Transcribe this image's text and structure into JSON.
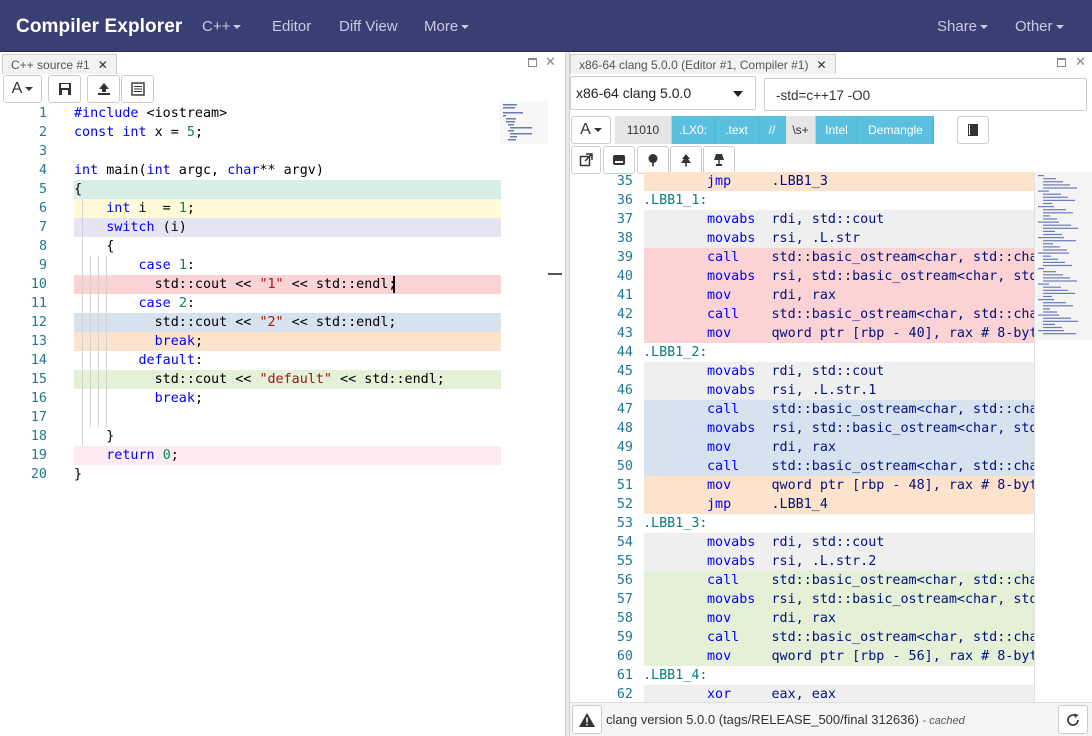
{
  "navbar": {
    "brand": "Compiler Explorer",
    "items": [
      "C++",
      "Editor",
      "Diff View",
      "More"
    ],
    "right_items": [
      "Share",
      "Other"
    ]
  },
  "source_pane": {
    "tab_title": "C++ source #1",
    "lines": [
      {
        "n": "1",
        "tokens": [
          [
            "kw",
            "#include"
          ],
          [
            "id",
            " <iostream>"
          ]
        ]
      },
      {
        "n": "2",
        "tokens": [
          [
            "kw",
            "const"
          ],
          [
            "id",
            " "
          ],
          [
            "kw",
            "int"
          ],
          [
            "id",
            " x = "
          ],
          [
            "num",
            "5"
          ],
          [
            "id",
            ";"
          ]
        ]
      },
      {
        "n": "3",
        "tokens": []
      },
      {
        "n": "4",
        "tokens": [
          [
            "kw",
            "int"
          ],
          [
            "id",
            " main("
          ],
          [
            "kw",
            "int"
          ],
          [
            "id",
            " argc, "
          ],
          [
            "kw",
            "char"
          ],
          [
            "id",
            "** argv)"
          ]
        ]
      },
      {
        "n": "5",
        "tokens": [
          [
            "id",
            "{"
          ]
        ]
      },
      {
        "n": "6",
        "tokens": [
          [
            "id",
            "    "
          ],
          [
            "kw",
            "int"
          ],
          [
            "id",
            " i  = "
          ],
          [
            "num",
            "1"
          ],
          [
            "id",
            ";"
          ]
        ]
      },
      {
        "n": "7",
        "tokens": [
          [
            "id",
            "    "
          ],
          [
            "kw",
            "switch"
          ],
          [
            "id",
            " (i)"
          ]
        ]
      },
      {
        "n": "8",
        "tokens": [
          [
            "id",
            "    {"
          ]
        ]
      },
      {
        "n": "9",
        "tokens": [
          [
            "id",
            "        "
          ],
          [
            "kw",
            "case"
          ],
          [
            "id",
            " "
          ],
          [
            "num",
            "1"
          ],
          [
            "id",
            ":"
          ]
        ]
      },
      {
        "n": "10",
        "tokens": [
          [
            "id",
            "          std::cout << "
          ],
          [
            "str",
            "\"1\""
          ],
          [
            "id",
            " << std::endl;"
          ]
        ]
      },
      {
        "n": "11",
        "tokens": [
          [
            "id",
            "        "
          ],
          [
            "kw",
            "case"
          ],
          [
            "id",
            " "
          ],
          [
            "num",
            "2"
          ],
          [
            "id",
            ":"
          ]
        ]
      },
      {
        "n": "12",
        "tokens": [
          [
            "id",
            "          std::cout << "
          ],
          [
            "str",
            "\"2\""
          ],
          [
            "id",
            " << std::endl;"
          ]
        ]
      },
      {
        "n": "13",
        "tokens": [
          [
            "id",
            "          "
          ],
          [
            "kw",
            "break"
          ],
          [
            "id",
            ";"
          ]
        ]
      },
      {
        "n": "14",
        "tokens": [
          [
            "id",
            "        "
          ],
          [
            "kw",
            "default"
          ],
          [
            "id",
            ":"
          ]
        ]
      },
      {
        "n": "15",
        "tokens": [
          [
            "id",
            "          std::cout << "
          ],
          [
            "str",
            "\"default\""
          ],
          [
            "id",
            " << std::endl;"
          ]
        ]
      },
      {
        "n": "16",
        "tokens": [
          [
            "id",
            "          "
          ],
          [
            "kw",
            "break"
          ],
          [
            "id",
            ";"
          ]
        ]
      },
      {
        "n": "17",
        "tokens": []
      },
      {
        "n": "18",
        "tokens": [
          [
            "id",
            "    }"
          ]
        ]
      },
      {
        "n": "19",
        "tokens": [
          [
            "id",
            "    "
          ],
          [
            "kw",
            "return"
          ],
          [
            "id",
            " "
          ],
          [
            "num",
            "0"
          ],
          [
            "id",
            ";"
          ]
        ]
      },
      {
        "n": "20",
        "tokens": [
          [
            "id",
            "}"
          ]
        ]
      }
    ],
    "highlights": {
      "5": "#d8efe8",
      "6": "#fdfbd8",
      "7": "#e6e4f3",
      "10": "#fbd3d4",
      "12": "#d6e3ef",
      "13": "#fde2cc",
      "15": "#e4f1d6",
      "19": "#fdeaf2"
    }
  },
  "compiler_pane": {
    "tab_title": "x86-64 clang 5.0.0 (Editor #1, Compiler #1)",
    "compiler_select": "x86-64 clang 5.0.0",
    "options_value": "-std=c++17 -O0",
    "filters": [
      {
        "label": "11010",
        "on": false
      },
      {
        "label": ".LX0:",
        "on": true
      },
      {
        "label": ".text",
        "on": true
      },
      {
        "label": "//",
        "on": true
      },
      {
        "label": "\\s+",
        "on": false
      },
      {
        "label": "Intel",
        "on": true
      },
      {
        "label": "Demangle",
        "on": true
      }
    ],
    "asm_lines": [
      {
        "n": "35",
        "label": "",
        "op": "jmp",
        "args": ".LBB1_3",
        "bg": "#fde2cc"
      },
      {
        "n": "36",
        "label": ".LBB1_1:",
        "op": "",
        "args": "",
        "bg": ""
      },
      {
        "n": "37",
        "label": "",
        "op": "movabs",
        "args": "rdi, std::cout",
        "bg": "#efefef"
      },
      {
        "n": "38",
        "label": "",
        "op": "movabs",
        "args": "rsi, .L.str",
        "bg": "#efefef"
      },
      {
        "n": "39",
        "label": "",
        "op": "call",
        "args": "std::basic_ostream<char, std::cha",
        "bg": "#fbd3d4"
      },
      {
        "n": "40",
        "label": "",
        "op": "movabs",
        "args": "rsi, std::basic_ostream<char, std",
        "bg": "#fbd3d4"
      },
      {
        "n": "41",
        "label": "",
        "op": "mov",
        "args": "rdi, rax",
        "bg": "#fbd3d4"
      },
      {
        "n": "42",
        "label": "",
        "op": "call",
        "args": "std::basic_ostream<char, std::cha",
        "bg": "#fbd3d4"
      },
      {
        "n": "43",
        "label": "",
        "op": "mov",
        "args": "qword ptr [rbp - 40], rax # 8-byt",
        "bg": "#fbd3d4"
      },
      {
        "n": "44",
        "label": ".LBB1_2:",
        "op": "",
        "args": "",
        "bg": ""
      },
      {
        "n": "45",
        "label": "",
        "op": "movabs",
        "args": "rdi, std::cout",
        "bg": "#efefef"
      },
      {
        "n": "46",
        "label": "",
        "op": "movabs",
        "args": "rsi, .L.str.1",
        "bg": "#efefef"
      },
      {
        "n": "47",
        "label": "",
        "op": "call",
        "args": "std::basic_ostream<char, std::cha",
        "bg": "#d6e3ef"
      },
      {
        "n": "48",
        "label": "",
        "op": "movabs",
        "args": "rsi, std::basic_ostream<char, std",
        "bg": "#d6e3ef"
      },
      {
        "n": "49",
        "label": "",
        "op": "mov",
        "args": "rdi, rax",
        "bg": "#d6e3ef"
      },
      {
        "n": "50",
        "label": "",
        "op": "call",
        "args": "std::basic_ostream<char, std::cha",
        "bg": "#d6e3ef"
      },
      {
        "n": "51",
        "label": "",
        "op": "mov",
        "args": "qword ptr [rbp - 48], rax # 8-byt",
        "bg": "#fde2cc"
      },
      {
        "n": "52",
        "label": "",
        "op": "jmp",
        "args": ".LBB1_4",
        "bg": "#fde2cc"
      },
      {
        "n": "53",
        "label": ".LBB1_3:",
        "op": "",
        "args": "",
        "bg": ""
      },
      {
        "n": "54",
        "label": "",
        "op": "movabs",
        "args": "rdi, std::cout",
        "bg": "#efefef"
      },
      {
        "n": "55",
        "label": "",
        "op": "movabs",
        "args": "rsi, .L.str.2",
        "bg": "#efefef"
      },
      {
        "n": "56",
        "label": "",
        "op": "call",
        "args": "std::basic_ostream<char, std::cha",
        "bg": "#e4f1d6"
      },
      {
        "n": "57",
        "label": "",
        "op": "movabs",
        "args": "rsi, std::basic_ostream<char, std",
        "bg": "#e4f1d6"
      },
      {
        "n": "58",
        "label": "",
        "op": "mov",
        "args": "rdi, rax",
        "bg": "#e4f1d6"
      },
      {
        "n": "59",
        "label": "",
        "op": "call",
        "args": "std::basic_ostream<char, std::cha",
        "bg": "#e4f1d6"
      },
      {
        "n": "60",
        "label": "",
        "op": "mov",
        "args": "qword ptr [rbp - 56], rax # 8-byt",
        "bg": "#e4f1d6"
      },
      {
        "n": "61",
        "label": ".LBB1_4:",
        "op": "",
        "args": "",
        "bg": ""
      },
      {
        "n": "62",
        "label": "",
        "op": "xor",
        "args": "eax, eax",
        "bg": "#efefef"
      }
    ],
    "status": {
      "text": "clang version 5.0.0 (tags/RELEASE_500/final 312636)",
      "suffix": "- cached"
    }
  },
  "colors": {
    "navbar": "#3a3f73",
    "accent": "#5bc0de"
  }
}
